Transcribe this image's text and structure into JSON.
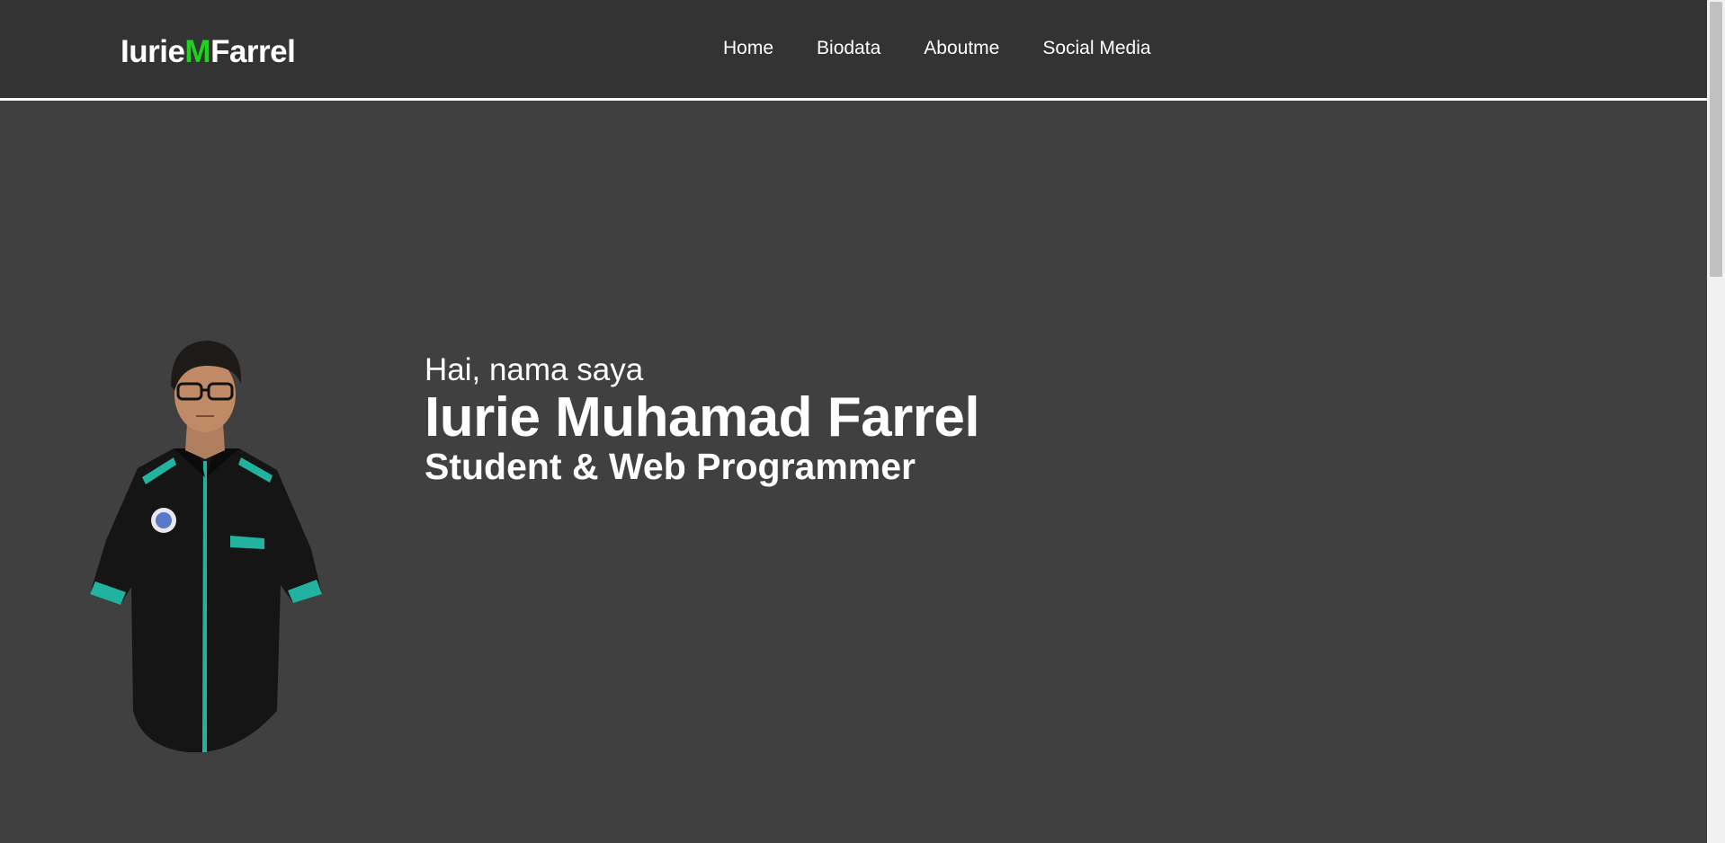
{
  "header": {
    "logo": {
      "part1": "Iurie",
      "part2": "M",
      "part3": "Farrel"
    },
    "nav": [
      {
        "label": "Home"
      },
      {
        "label": "Biodata"
      },
      {
        "label": "Aboutme"
      },
      {
        "label": "Social Media"
      }
    ]
  },
  "hero": {
    "greeting": "Hai, nama saya",
    "name": "Iurie Muhamad Farrel",
    "role": "Student & Web Programmer"
  },
  "colors": {
    "background": "#404040",
    "navbar": "#333333",
    "accent": "#1ed31e",
    "text": "#ffffff"
  }
}
